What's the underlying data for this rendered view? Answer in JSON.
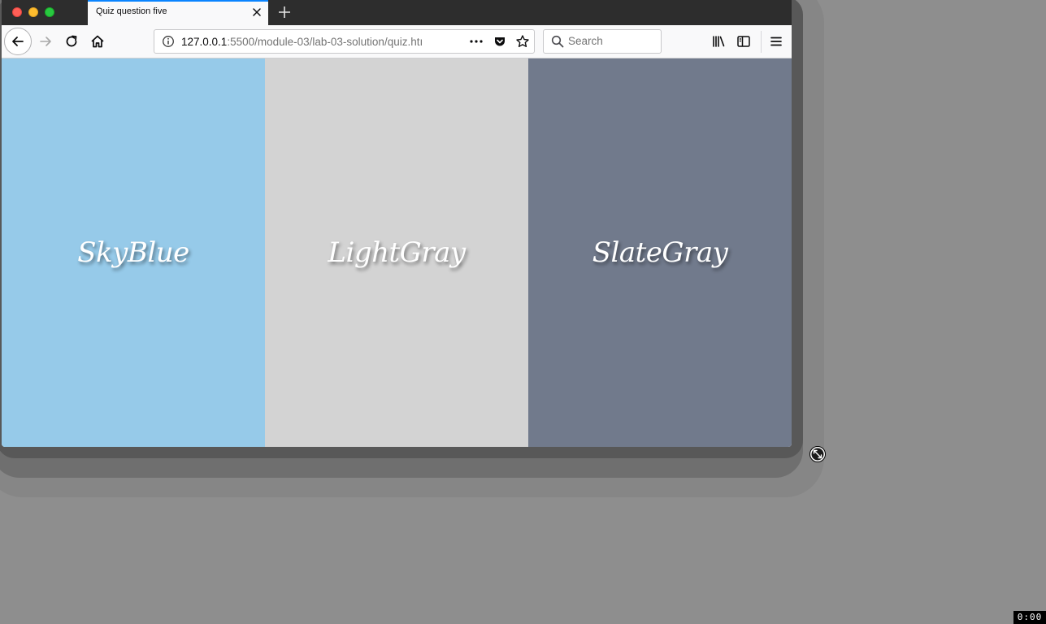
{
  "browser": {
    "tab": {
      "title": "Quiz question five"
    },
    "url": {
      "host": "127.0.0.1",
      "rest": ":5500/module-03/lab-03-solution/quiz.htı"
    },
    "search": {
      "placeholder": "Search"
    }
  },
  "swatches": [
    {
      "label": "SkyBlue",
      "color": "#96cae9"
    },
    {
      "label": "LightGray",
      "color": "#d3d3d3"
    },
    {
      "label": "SlateGray",
      "color": "#717a8c"
    }
  ],
  "recording": {
    "timecode": "0:00"
  },
  "icons": {
    "tab_close": "close-icon",
    "new_tab": "plus-icon",
    "back": "arrow-left-icon",
    "forward": "arrow-right-icon",
    "reload": "reload-icon",
    "home": "home-icon",
    "info": "info-icon",
    "more": "ellipsis-icon",
    "pocket": "pocket-icon",
    "bookmark": "star-icon",
    "search": "search-icon",
    "library": "library-icon",
    "sidebar": "sidebar-icon",
    "menu": "hamburger-menu-icon",
    "cursor": "resize-cursor-icon"
  }
}
